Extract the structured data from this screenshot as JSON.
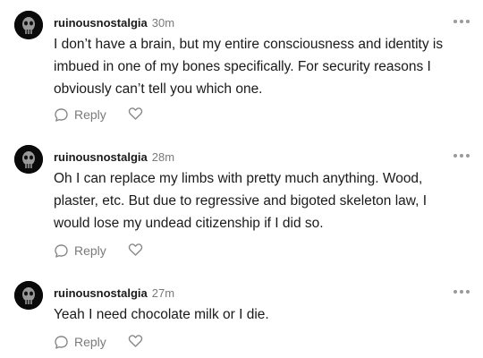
{
  "comments": [
    {
      "username": "ruinousnostalgia",
      "time": "30m",
      "text": "I don’t have a brain, but my entire consciousness and identity is imbued in one of my bones specifically. For security reasons I obviously can’t tell you which one.",
      "reply_label": "Reply"
    },
    {
      "username": "ruinousnostalgia",
      "time": "28m",
      "text": "Oh I can replace my limbs with pretty much anything. Wood, plaster, etc. But due to regressive and bigoted skeleton law, I would lose my undead citizenship if I did so.",
      "reply_label": "Reply"
    },
    {
      "username": "ruinousnostalgia",
      "time": "27m",
      "text": "Yeah I need chocolate milk or I die.",
      "reply_label": "Reply"
    }
  ],
  "icons": {
    "avatar": "skull-avatar",
    "more": "more-dots-icon",
    "reply": "speech-bubble-icon",
    "like": "heart-icon"
  },
  "colors": {
    "text": "#1a1a1a",
    "muted": "#7a7a7a",
    "icon": "#888888",
    "avatar_bg": "#0a0a0a"
  }
}
